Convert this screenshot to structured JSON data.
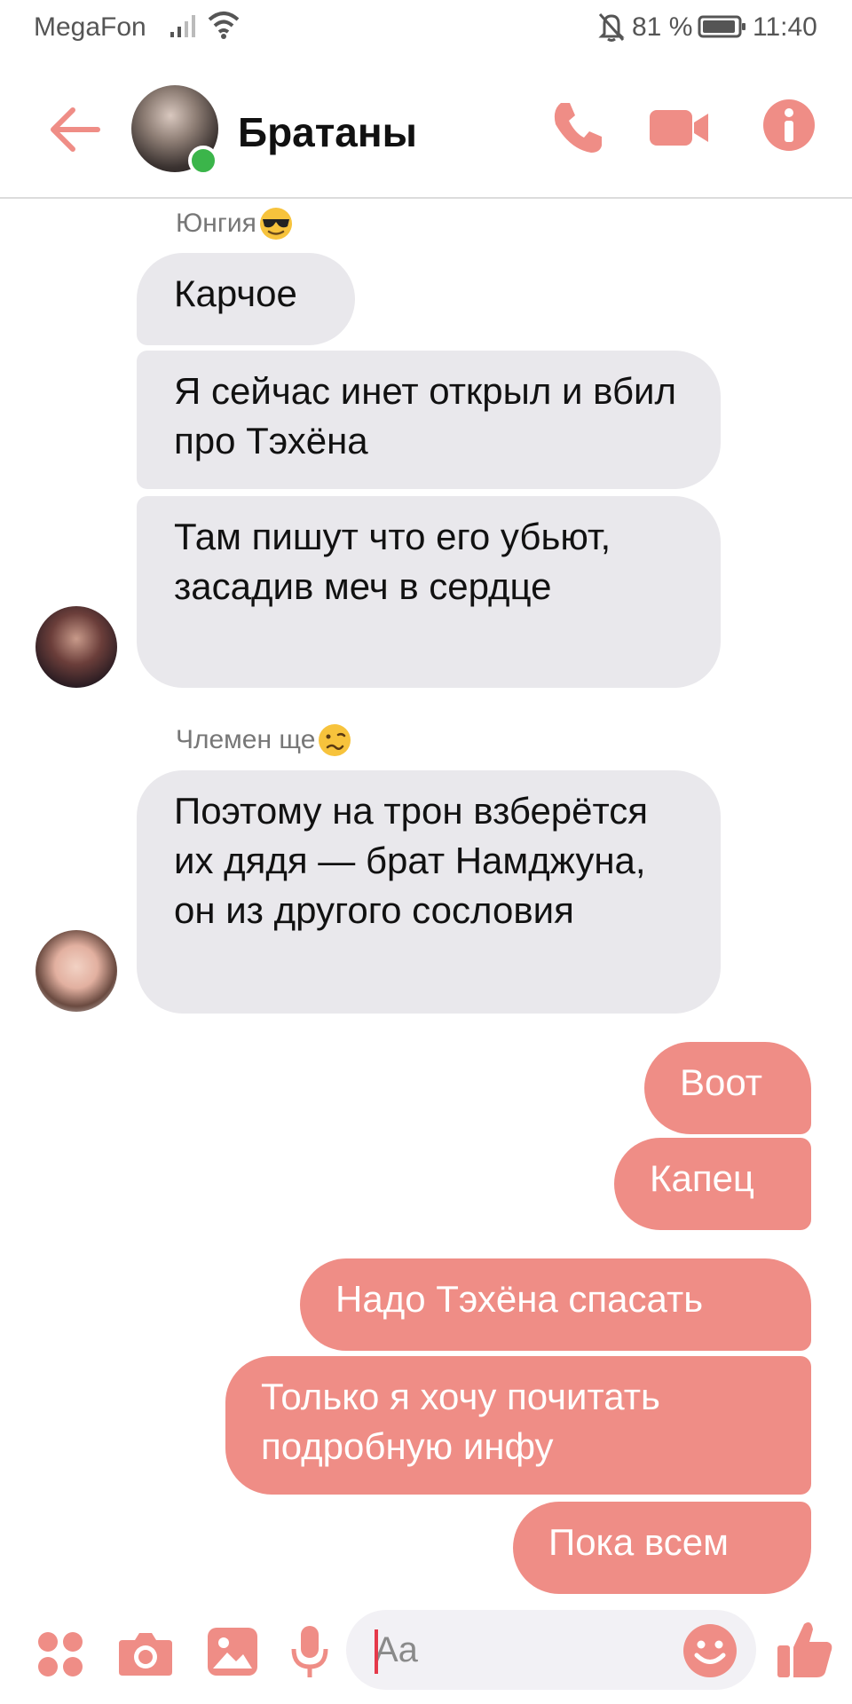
{
  "status_bar": {
    "carrier": "MegaFon",
    "battery_percent": "81 %",
    "time": "11:40"
  },
  "header": {
    "title": "Братаны",
    "online": true
  },
  "messages": [
    {
      "direction": "in",
      "sender": "Юнгия",
      "sender_emoji": "smiling-face-with-sunglasses",
      "text": "Карчое"
    },
    {
      "direction": "in",
      "text": "Я сейчас инет открыл и вбил про Тэхёна"
    },
    {
      "direction": "in",
      "text": "Там пишут что его убьют, засадив меч в сердце"
    },
    {
      "direction": "in",
      "sender": "Члемен ще",
      "sender_emoji": "woozy-face",
      "text": "Поэтому на трон взберётся их дядя — брат Намджуна, он из другого сословия"
    },
    {
      "direction": "out",
      "text": "Воот"
    },
    {
      "direction": "out",
      "text": "Капец"
    },
    {
      "direction": "out",
      "text": "Надо Тэхёна спасать"
    },
    {
      "direction": "out",
      "text": "Только я хочу почитать подробную инфу"
    },
    {
      "direction": "out",
      "text": "Пока всем"
    }
  ],
  "composer": {
    "placeholder": "Aa",
    "icons": [
      "apps-icon",
      "camera-icon",
      "gallery-icon",
      "microphone-icon",
      "emoji-icon",
      "thumbs-up-icon"
    ]
  },
  "colors": {
    "accent": "#ef8d86",
    "incoming_bubble": "#e9e8ec",
    "online": "#3bb54a"
  }
}
